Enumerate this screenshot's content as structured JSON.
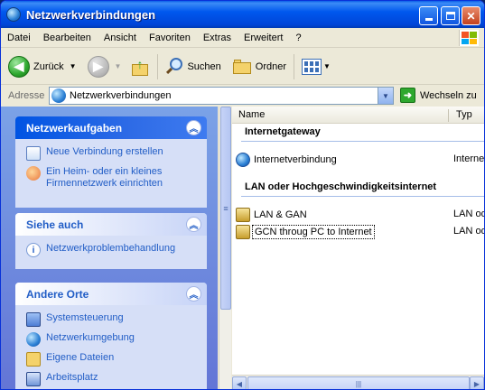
{
  "window": {
    "title": "Netzwerkverbindungen",
    "minimize_icon": "minimize-icon",
    "maximize_icon": "maximize-icon",
    "close_icon": "close-icon",
    "close_glyph": "✕"
  },
  "menu": [
    "Datei",
    "Bearbeiten",
    "Ansicht",
    "Favoriten",
    "Extras",
    "Erweitert",
    "?"
  ],
  "toolbar": {
    "back_label": "Zurück",
    "back_glyph": "◀",
    "forward_glyph": "▶",
    "search_label": "Suchen",
    "folders_label": "Ordner",
    "drop_glyph": "▼"
  },
  "address": {
    "label": "Adresse",
    "value": "Netzwerkverbindungen",
    "go_label": "Wechseln zu",
    "go_glyph": "➜"
  },
  "taskpane": {
    "network_tasks": {
      "title": "Netzwerkaufgaben",
      "items": [
        "Neue Verbindung erstellen",
        "Ein Heim- oder ein kleines Firmennetzwerk einrichten"
      ]
    },
    "see_also": {
      "title": "Siehe auch",
      "items": [
        "Netzwerkproblembehandlung"
      ]
    },
    "other_places": {
      "title": "Andere Orte",
      "items": [
        "Systemsteuerung",
        "Netzwerkumgebung",
        "Eigene Dateien",
        "Arbeitsplatz"
      ]
    },
    "collapse_glyph": "︽"
  },
  "list": {
    "col_name": "Name",
    "col_type": "Typ",
    "groups": [
      {
        "title": "Internetgateway",
        "rows": [
          {
            "name": "Internetverbindung",
            "type": "Interne"
          }
        ]
      },
      {
        "title": "LAN oder Hochgeschwindigkeitsinternet",
        "rows": [
          {
            "name": "LAN & GAN",
            "type": "LAN od"
          },
          {
            "name": "GCN throug PC to Internet",
            "type": "LAN od"
          }
        ]
      }
    ]
  },
  "scroll": {
    "left_glyph": "◀",
    "right_glyph": "▶",
    "grip_glyph": "≡",
    "thumb_grip": "|||"
  }
}
